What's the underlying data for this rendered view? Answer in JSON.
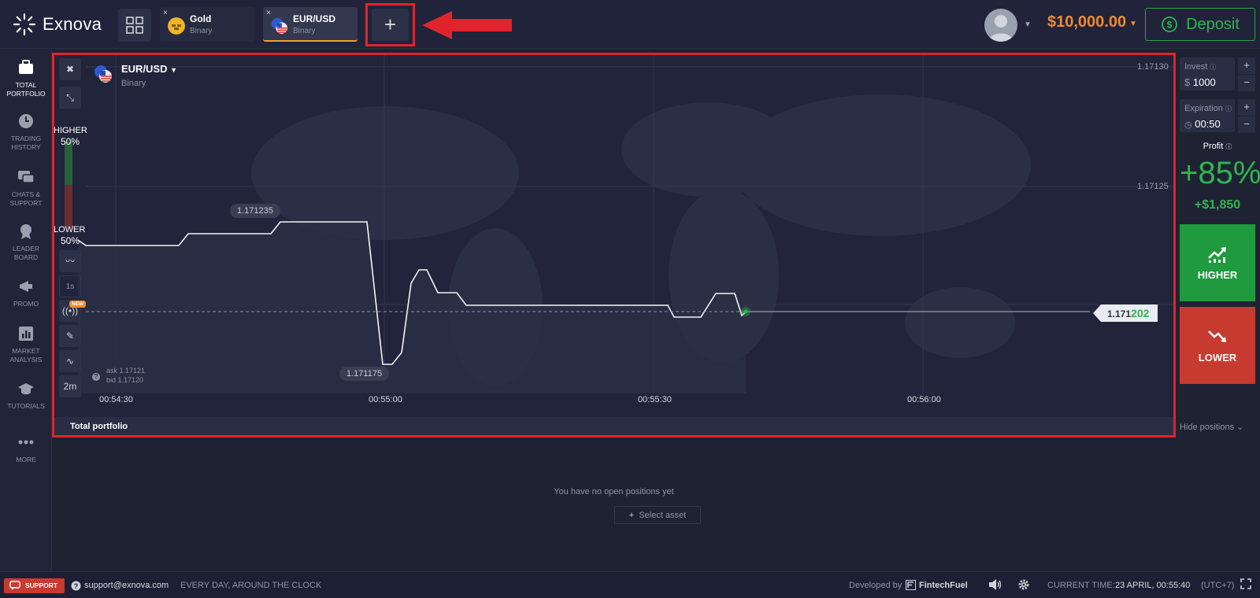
{
  "app": {
    "logo_text": "Exnova"
  },
  "tabs": [
    {
      "name": "Gold",
      "sub": "Binary",
      "close": "×"
    },
    {
      "name": "EUR/USD",
      "sub": "Binary",
      "close": "×"
    }
  ],
  "add_tab_label": "+",
  "balance": "$10,000.00",
  "deposit_label": "Deposit",
  "sidebar": {
    "items": [
      {
        "label": "TOTAL PORTFOLIO",
        "icon": "briefcase-icon"
      },
      {
        "label": "TRADING HISTORY",
        "icon": "clock-icon"
      },
      {
        "label": "CHATS & SUPPORT",
        "icon": "chat-icon"
      },
      {
        "label": "LEADER BOARD",
        "icon": "medal-icon"
      },
      {
        "label": "PROMO",
        "icon": "megaphone-icon"
      },
      {
        "label": "MARKET ANALYSIS",
        "icon": "bar-chart-icon"
      },
      {
        "label": "TUTORIALS",
        "icon": "graduation-cap-icon"
      },
      {
        "label": "MORE",
        "icon": "dots-icon"
      }
    ]
  },
  "chart": {
    "asset_name": "EUR/USD",
    "asset_sub": "Binary",
    "higher_label": "HIGHER",
    "higher_pct": "50%",
    "lower_label": "LOWER",
    "lower_pct": "50%",
    "tool_timeframe": "1s",
    "new_badge": "NEW",
    "tool_period": "2m",
    "ask": "ask 1.17121",
    "bid": "bid 1.17120",
    "help_mark": "?",
    "pill_high": "1.171235",
    "pill_low": "1.171175",
    "current_price_main": "1.171",
    "current_price_tail": "202",
    "y_ticks": [
      "1.17130",
      "1.17125"
    ],
    "x_ticks": [
      "00:54:30",
      "00:55:00",
      "00:55:30",
      "00:56:00"
    ],
    "total_portfolio_label": "Total portfolio"
  },
  "right_panel": {
    "invest_label": "Invest",
    "invest_currency": "$",
    "invest_value": "1000",
    "expiration_label": "Expiration",
    "expiration_value": "00:50",
    "step_plus": "+",
    "step_minus": "−",
    "profit_label": "Profit",
    "profit_pct": "+85%",
    "profit_amount": "+$1,850",
    "higher_button": "HIGHER",
    "lower_button": "LOWER",
    "hide_positions": "Hide positions"
  },
  "positions": {
    "empty_message": "You have no open positions yet",
    "select_asset": "Select asset"
  },
  "footer": {
    "support_label": "SUPPORT",
    "email": "support@exnova.com",
    "hours": "EVERY DAY, AROUND THE CLOCK",
    "developed_by": "Developed by",
    "developer": "FintechFuel",
    "current_time_label": "CURRENT TIME:",
    "current_time_value": "23 APRIL, 00:55:40",
    "timezone": "(UTC+7)"
  },
  "colors": {
    "accent_orange": "#f08a2c",
    "green": "#2fb54f",
    "red": "#c73a2f",
    "highlight_red": "#e0242c"
  }
}
